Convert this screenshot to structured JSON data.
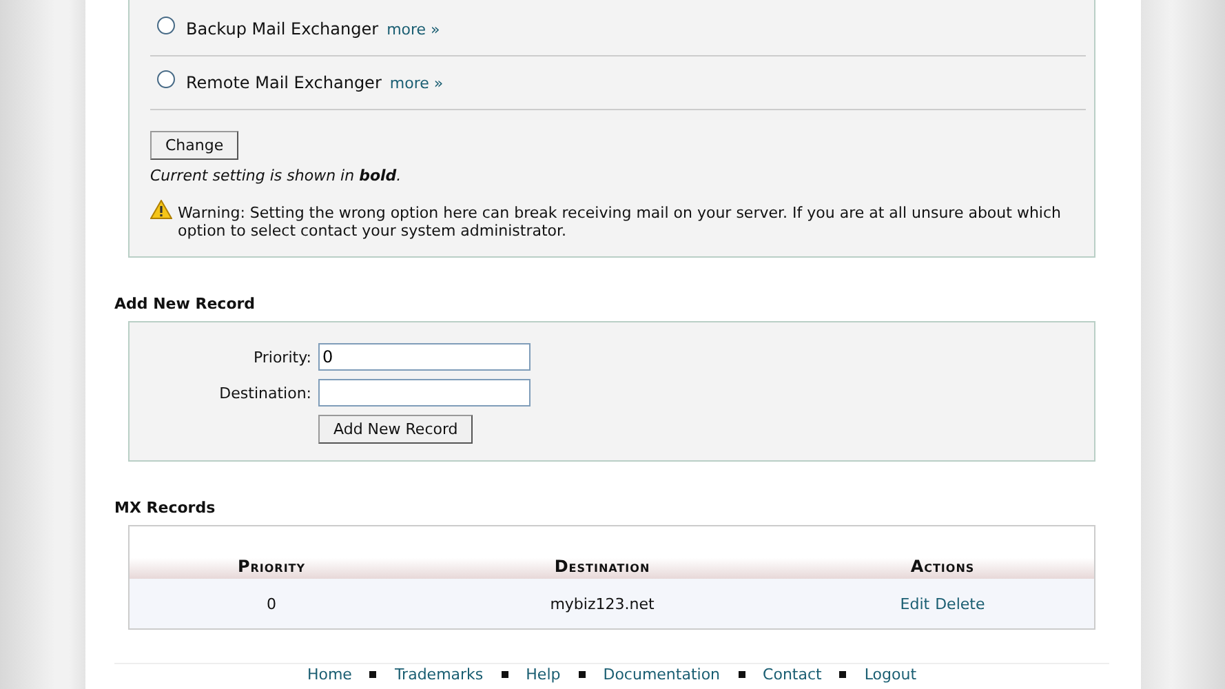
{
  "mx_options": {
    "options": [
      {
        "label": "Backup Mail Exchanger",
        "link": "more »",
        "selected": false
      },
      {
        "label": "Remote Mail Exchanger",
        "link": "more »",
        "selected": false
      }
    ],
    "button": "Change",
    "note": "Current setting is shown in **bold**.",
    "warning": "Warning: Setting the wrong option here can break receiving mail on your server. If you are at all unsure about which option to select contact your system administrator."
  },
  "add_record": {
    "heading": "Add New Record",
    "fields": [
      {
        "label": "Priority:",
        "value": "0"
      },
      {
        "label": "Destination:"
      }
    ],
    "button": "Add New Record"
  },
  "mx_records": {
    "heading": "MX Records",
    "columns": [
      "Priority",
      "Destination",
      "Actions"
    ],
    "rows": [
      {
        "priority": "0",
        "destination": "mybiz123.net",
        "actions": [
          "Edit",
          "Delete"
        ]
      }
    ]
  },
  "footer": {
    "links": [
      "Home",
      "Trademarks",
      "Help",
      "Documentation",
      "Contact",
      "Logout"
    ]
  }
}
